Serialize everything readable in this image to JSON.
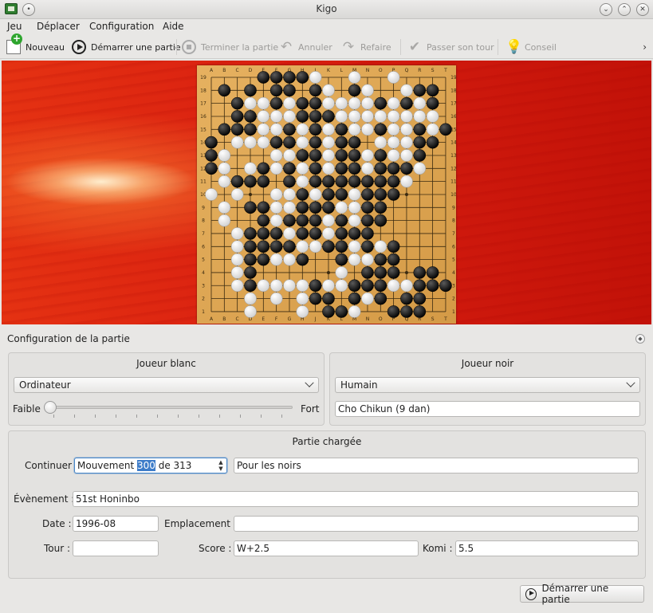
{
  "window": {
    "title": "Kigo"
  },
  "menu": [
    "Jeu",
    "Déplacer",
    "Configuration",
    "Aide"
  ],
  "toolbar": {
    "new": "Nouveau",
    "start": "Démarrer une partie",
    "finish": "Terminer la partie",
    "undo": "Annuler",
    "redo": "Refaire",
    "pass": "Passer son tour",
    "hint": "Conseil"
  },
  "board": {
    "size": 19,
    "columns": [
      "A",
      "B",
      "C",
      "D",
      "E",
      "F",
      "G",
      "H",
      "J",
      "K",
      "L",
      "M",
      "N",
      "O",
      "P",
      "Q",
      "R",
      "S",
      "T"
    ],
    "rows": [
      "19",
      "18",
      "17",
      "16",
      "15",
      "14",
      "13",
      "12",
      "11",
      "10",
      "9",
      "8",
      "7",
      "6",
      "5",
      "4",
      "3",
      "2",
      "1"
    ],
    "stones": [
      "....BBBBW..W..W....",
      ".B.B.BB.BW.BW..WBB.",
      "..BWWBWBBWWWWBWBWB.",
      "..BBWWWBBBWWWWWWWW.",
      ".BBBWWBWBWBWWBWWBWB",
      "B.WWWBBWBWBB.WWWBB.",
      "BW...WWBBWBBWBWWB..",
      "BW.WBWBWBWBBWBBBW..",
      ".WBBB.BWBBBBBBBW...",
      "W.W..WWBWBBWBBB....",
      ".W.BBWWBBBWWBB.....",
      ".W..BWBBBWBWBB.....",
      "..WBBBWBBWBBB......",
      "..WBBBBWWBBWBWB....",
      "..WBBWWB..BWWBB....",
      "..WB......W.BBB.BB.",
      "..WBWWWWBWWBBBWWBBB",
      "...W.W.WBB.BWB.BB..",
      "...W...W.BBW..BBB.."
    ]
  },
  "config": {
    "title": "Configuration de la partie",
    "white": {
      "title": "Joueur blanc",
      "type": "Ordinateur",
      "weak": "Faible",
      "strong": "Fort",
      "strength": 0
    },
    "black": {
      "title": "Joueur noir",
      "type": "Humain",
      "name": "Cho Chikun (9 dan)"
    },
    "loaded": {
      "title": "Partie chargée",
      "continue_label": "Continuer",
      "move_prefix": "Mouvement ",
      "move_number": "300",
      "move_suffix": " de 313",
      "turn": "Pour les noirs",
      "event_label": "Évènement :",
      "event": "51st Honinbo",
      "date_label": "Date :",
      "date": "1996-08",
      "place_label": "Emplacement :",
      "place": "",
      "round_label": "Tour :",
      "round": "",
      "score_label": "Score :",
      "score": "W+2.5",
      "komi_label": "Komi :",
      "komi": "5.5"
    },
    "start_button": "Démarrer une partie"
  }
}
